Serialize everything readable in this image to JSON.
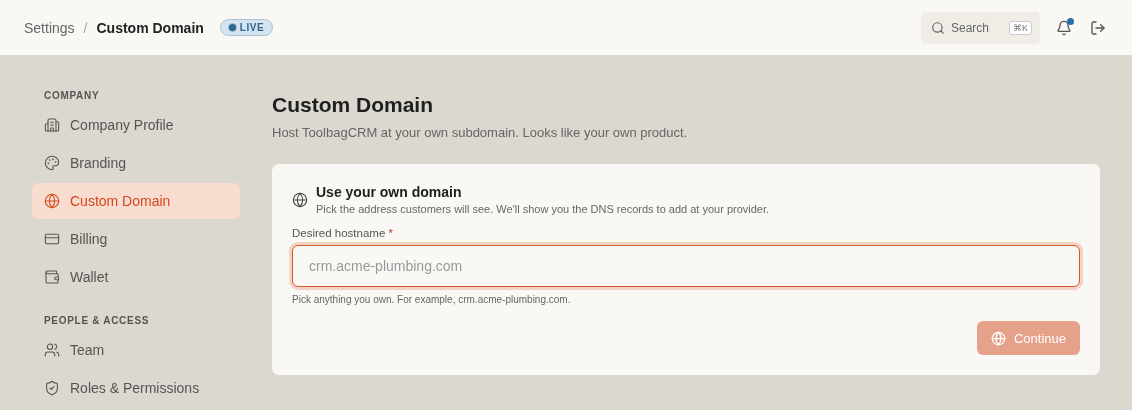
{
  "header": {
    "breadcrumb": [
      {
        "label": "Settings",
        "current": false
      },
      {
        "label": "Custom Domain",
        "current": true
      }
    ],
    "separator": "/",
    "status_badge": {
      "label": "LIVE"
    },
    "search": {
      "label": "Search",
      "shortcut": "⌘K"
    },
    "notifications": {
      "unread": true
    }
  },
  "sidebar": {
    "sections": [
      {
        "title": "COMPANY",
        "items": [
          {
            "label": "Company Profile",
            "selected": false
          },
          {
            "label": "Branding",
            "selected": false
          },
          {
            "label": "Custom Domain",
            "selected": true
          },
          {
            "label": "Billing",
            "selected": false
          },
          {
            "label": "Wallet",
            "selected": false
          }
        ]
      },
      {
        "title": "PEOPLE & ACCESS",
        "items": [
          {
            "label": "Team",
            "selected": false
          },
          {
            "label": "Roles & Permissions",
            "selected": false
          }
        ]
      }
    ]
  },
  "page": {
    "title": "Custom Domain",
    "subtitle": "Host ToolbagCRM at your own subdomain. Looks like your own product."
  },
  "card": {
    "title": "Use your own domain",
    "description": "Pick the address customers will see. We'll show you the DNS records to add at your provider.",
    "field": {
      "label": "Desired hostname",
      "required_mark": "*",
      "placeholder": "crm.acme-plumbing.com",
      "focused": true,
      "help": "Pick anything you own. For example, crm.acme-plumbing.com."
    },
    "button": {
      "label": "Continue",
      "disabled": true
    }
  }
}
